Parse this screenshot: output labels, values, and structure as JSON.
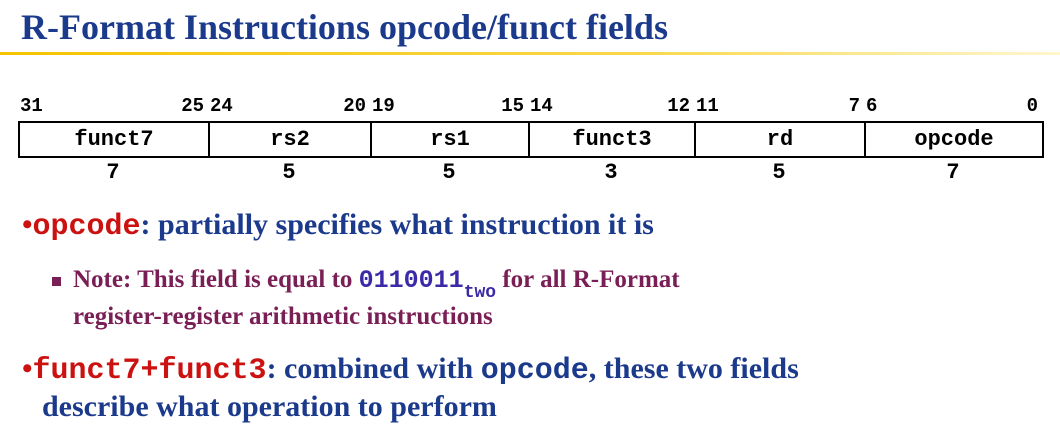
{
  "title": "R-Format Instructions opcode/funct fields",
  "bit_positions": [
    {
      "hi": "31",
      "lo": "25"
    },
    {
      "hi": "24",
      "lo": "20"
    },
    {
      "hi": "19",
      "lo": "15"
    },
    {
      "hi": "14",
      "lo": "12"
    },
    {
      "hi": "11",
      "lo": "7"
    },
    {
      "hi": "6",
      "lo": "0"
    }
  ],
  "fields": [
    {
      "name": "funct7",
      "width": "7"
    },
    {
      "name": "rs2",
      "width": "5"
    },
    {
      "name": "rs1",
      "width": "5"
    },
    {
      "name": "funct3",
      "width": "3"
    },
    {
      "name": "rd",
      "width": "5"
    },
    {
      "name": "opcode",
      "width": "7"
    }
  ],
  "bullet1": {
    "marker": "•",
    "code": "opcode",
    "text": ": partially specifies what instruction it is"
  },
  "sub_bullet": {
    "text_before": "Note: This field is equal to ",
    "code": "0110011",
    "subscript": "two",
    "text_after": " for all R-Format",
    "line2": "register-register arithmetic instructions"
  },
  "bullet2": {
    "marker": "•",
    "code": "funct7+funct3",
    "text_mid": ": combined with ",
    "code2": "opcode",
    "text_end": ", these two fields",
    "line2": "describe what operation to perform"
  },
  "colors": {
    "title": "#1b3a8c",
    "accent_rule": "#f5c300",
    "code_red": "#cc1111",
    "sub_text": "#7a1f55",
    "code_blue": "#3a2aa8"
  }
}
